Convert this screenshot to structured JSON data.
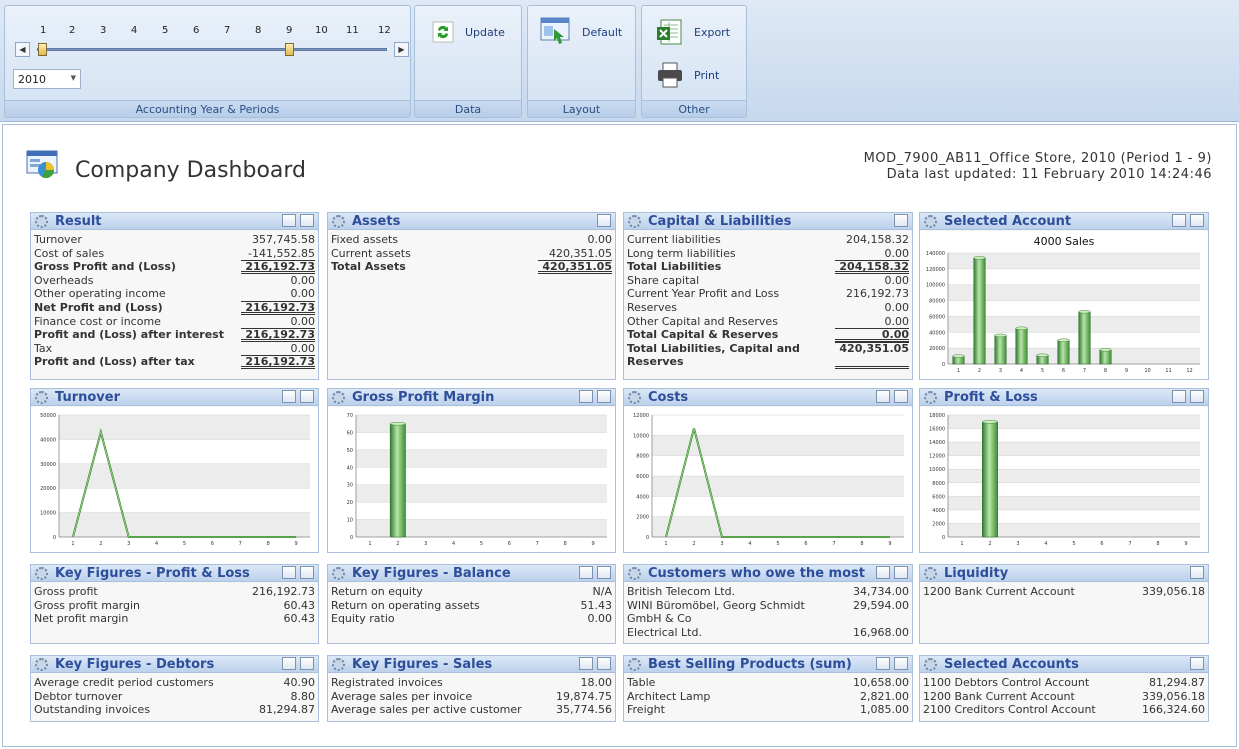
{
  "ribbon": {
    "periods": [
      "1",
      "2",
      "3",
      "4",
      "5",
      "6",
      "7",
      "8",
      "9",
      "10",
      "11",
      "12"
    ],
    "year": "2010",
    "groups": {
      "accounting": "Accounting Year & Periods",
      "data": "Data",
      "layout": "Layout",
      "other": "Other"
    },
    "buttons": {
      "update": "Update",
      "default": "Default",
      "export": "Export",
      "print": "Print"
    }
  },
  "header": {
    "title": "Company Dashboard",
    "company": "MOD_7900_AB11_Office Store, 2010 (Period 1 - 9)",
    "updated": "Data last updated: 11 February 2010 14:24:46"
  },
  "panels": {
    "result": {
      "title": "Result",
      "rows": [
        {
          "label": "Turnover",
          "value": "357,745.58"
        },
        {
          "label": "Cost of sales",
          "value": "-141,552.85"
        },
        {
          "label": "Gross Profit and (Loss)",
          "value": "216,192.73",
          "bold": true
        },
        {
          "label": "Overheads",
          "value": "0.00"
        },
        {
          "label": "Other operating income",
          "value": "0.00"
        },
        {
          "label": "Net Profit and (Loss)",
          "value": "216,192.73",
          "bold": true
        },
        {
          "label": "Finance cost or income",
          "value": "0.00"
        },
        {
          "label": "Profit and (Loss) after interest",
          "value": "216,192.73",
          "bold": true
        },
        {
          "label": "Tax",
          "value": "0.00"
        },
        {
          "label": "Profit and (Loss) after tax",
          "value": "216,192.73",
          "bold": true
        }
      ]
    },
    "assets": {
      "title": "Assets",
      "rows": [
        {
          "label": "Fixed assets",
          "value": "0.00"
        },
        {
          "label": "Current assets",
          "value": "420,351.05"
        },
        {
          "label": "Total Assets",
          "value": "420,351.05",
          "bold": true
        }
      ]
    },
    "capital": {
      "title": "Capital & Liabilities",
      "rows": [
        {
          "label": "Current liabilities",
          "value": "204,158.32"
        },
        {
          "label": "Long term liabilities",
          "value": "0.00"
        },
        {
          "label": "Total Liabilities",
          "value": "204,158.32",
          "bold": true
        },
        {
          "label": "Share capital",
          "value": "0.00"
        },
        {
          "label": "Current Year Profit and Loss",
          "value": "216,192.73"
        },
        {
          "label": "Reserves",
          "value": "0.00"
        },
        {
          "label": "Other Capital and Reserves",
          "value": "0.00"
        },
        {
          "label": "Total Capital & Reserves",
          "value": "0.00",
          "bold": true
        },
        {
          "label": "Total Liabilities, Capital and Reserves",
          "value": "420,351.05",
          "bold": true
        }
      ]
    },
    "selected_account": {
      "title": "Selected Account"
    },
    "turnover": {
      "title": "Turnover"
    },
    "gpm": {
      "title": "Gross Profit Margin"
    },
    "costs": {
      "title": "Costs"
    },
    "pl": {
      "title": "Profit & Loss"
    },
    "kf_pl": {
      "title": "Key Figures - Profit & Loss",
      "rows": [
        {
          "label": "Gross profit",
          "value": "216,192.73"
        },
        {
          "label": "Gross profit margin",
          "value": "60.43"
        },
        {
          "label": "Net profit margin",
          "value": "60.43"
        }
      ]
    },
    "kf_bal": {
      "title": "Key Figures - Balance",
      "rows": [
        {
          "label": "Return on equity",
          "value": "N/A"
        },
        {
          "label": "Return on operating assets",
          "value": "51.43"
        },
        {
          "label": "Equity ratio",
          "value": "0.00"
        }
      ]
    },
    "customers": {
      "title": "Customers who owe the most",
      "rows": [
        {
          "label": "British Telecom Ltd.",
          "value": "34,734.00"
        },
        {
          "label": "WINI Büromöbel, Georg Schmidt GmbH & Co",
          "value": "29,594.00"
        },
        {
          "label": "Electrical Ltd.",
          "value": "16,968.00"
        }
      ]
    },
    "liquidity": {
      "title": "Liquidity",
      "rows": [
        {
          "label": "1200 Bank Current Account",
          "value": "339,056.18"
        }
      ]
    },
    "kf_deb": {
      "title": "Key Figures - Debtors",
      "rows": [
        {
          "label": "Average credit period customers",
          "value": "40.90"
        },
        {
          "label": "Debtor turnover",
          "value": "8.80"
        },
        {
          "label": "Outstanding invoices",
          "value": "81,294.87"
        }
      ]
    },
    "kf_sales": {
      "title": "Key Figures - Sales",
      "rows": [
        {
          "label": "Registrated invoices",
          "value": "18.00"
        },
        {
          "label": "Average sales per invoice",
          "value": "19,874.75"
        },
        {
          "label": "Average sales per active customer",
          "value": "35,774.56"
        }
      ]
    },
    "best": {
      "title": "Best Selling Products (sum)",
      "rows": [
        {
          "label": "Table",
          "value": "10,658.00"
        },
        {
          "label": "Architect Lamp",
          "value": "2,821.00"
        },
        {
          "label": "Freight",
          "value": "1,085.00"
        }
      ]
    },
    "sel_accounts": {
      "title": "Selected Accounts",
      "rows": [
        {
          "label": "1100 Debtors Control Account",
          "value": "81,294.87"
        },
        {
          "label": "1200 Bank Current Account",
          "value": "339,056.18"
        },
        {
          "label": "2100 Creditors Control Account",
          "value": "166,324.60"
        }
      ]
    }
  },
  "chart_data": [
    {
      "id": "selected_account",
      "type": "bar",
      "title": "4000 Sales",
      "categories": [
        "1",
        "2",
        "3",
        "4",
        "5",
        "6",
        "7",
        "8",
        "9",
        "10",
        "11",
        "12"
      ],
      "values": [
        10000,
        134000,
        36000,
        45000,
        11000,
        30000,
        66000,
        18000,
        0,
        0,
        0,
        0
      ],
      "yticks": [
        "0",
        "20000",
        "40000",
        "60000",
        "80000",
        "100000",
        "120000",
        "140000"
      ],
      "ylim": [
        0,
        140000
      ]
    },
    {
      "id": "turnover",
      "type": "line",
      "categories": [
        "1",
        "2",
        "3",
        "4",
        "5",
        "6",
        "7",
        "8",
        "9"
      ],
      "values": [
        0,
        43000,
        0,
        0,
        0,
        0,
        0,
        0,
        0
      ],
      "yticks": [
        "0",
        "10000",
        "20000",
        "30000",
        "40000",
        "50000"
      ],
      "ylim": [
        0,
        50000
      ]
    },
    {
      "id": "gpm",
      "type": "bar",
      "categories": [
        "1",
        "2",
        "3",
        "4",
        "5",
        "6",
        "7",
        "8",
        "9"
      ],
      "values": [
        0,
        65,
        0,
        0,
        0,
        0,
        0,
        0,
        0
      ],
      "yticks": [
        "0",
        "10",
        "20",
        "30",
        "40",
        "50",
        "60",
        "70"
      ],
      "ylim": [
        0,
        70
      ]
    },
    {
      "id": "costs",
      "type": "line",
      "categories": [
        "1",
        "2",
        "3",
        "4",
        "5",
        "6",
        "7",
        "8",
        "9"
      ],
      "values": [
        0,
        10700,
        0,
        0,
        0,
        0,
        0,
        0,
        0
      ],
      "yticks": [
        "0",
        "2000",
        "4000",
        "6000",
        "8000",
        "10000",
        "12000"
      ],
      "ylim": [
        0,
        12000
      ]
    },
    {
      "id": "pl",
      "type": "bar",
      "categories": [
        "1",
        "2",
        "3",
        "4",
        "5",
        "6",
        "7",
        "8",
        "9"
      ],
      "values": [
        0,
        17000,
        0,
        0,
        0,
        0,
        0,
        0,
        0
      ],
      "yticks": [
        "0",
        "2000",
        "4000",
        "6000",
        "8000",
        "10000",
        "12000",
        "14000",
        "16000",
        "18000"
      ],
      "ylim": [
        0,
        18000
      ]
    }
  ]
}
